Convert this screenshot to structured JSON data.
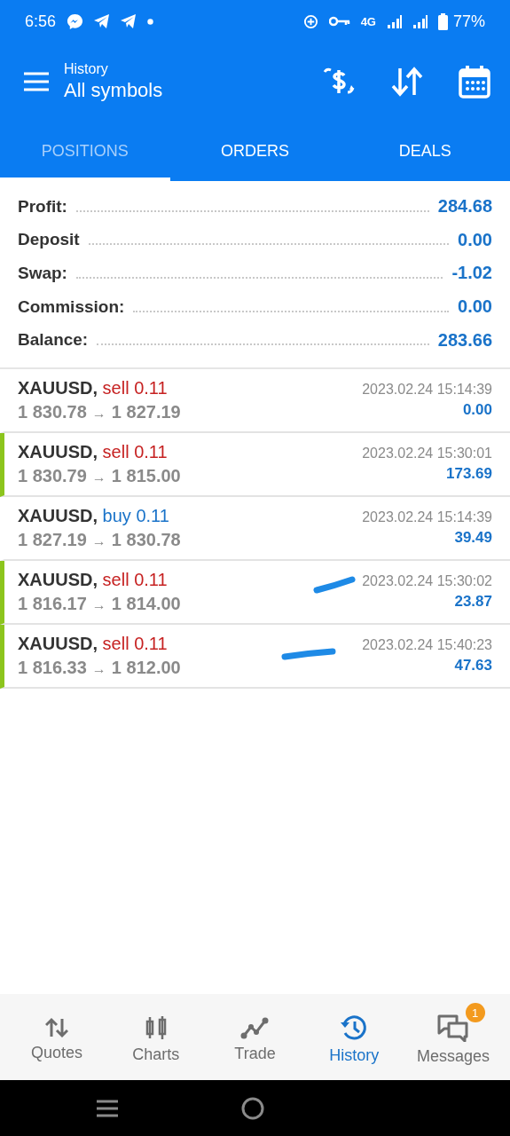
{
  "status_bar": {
    "time": "6:56",
    "battery": "77%",
    "network": "4G"
  },
  "header": {
    "subtitle": "History",
    "title": "All symbols"
  },
  "tabs": [
    {
      "label": "POSITIONS",
      "selected": true
    },
    {
      "label": "ORDERS",
      "selected": false
    },
    {
      "label": "DEALS",
      "selected": false
    }
  ],
  "summary": [
    {
      "label": "Profit:",
      "value": "284.68"
    },
    {
      "label": "Deposit",
      "value": "0.00"
    },
    {
      "label": "Swap:",
      "value": "-1.02"
    },
    {
      "label": "Commission:",
      "value": "0.00"
    },
    {
      "label": "Balance:",
      "value": "283.66"
    }
  ],
  "positions": [
    {
      "symbol": "XAUUSD,",
      "kind": "sell",
      "deal": "sell 0.11",
      "open": "1 830.78",
      "arrow": "→",
      "close": "1 827.19",
      "time": "2023.02.24 15:14:39",
      "profit": "0.00",
      "marked": false,
      "pen_mark": false
    },
    {
      "symbol": "XAUUSD,",
      "kind": "sell",
      "deal": "sell 0.11",
      "open": "1 830.79",
      "arrow": "→",
      "close": "1 815.00",
      "time": "2023.02.24 15:30:01",
      "profit": "173.69",
      "marked": true,
      "pen_mark": false
    },
    {
      "symbol": "XAUUSD,",
      "kind": "buy",
      "deal": "buy 0.11",
      "open": "1 827.19",
      "arrow": "→",
      "close": "1 830.78",
      "time": "2023.02.24 15:14:39",
      "profit": "39.49",
      "marked": false,
      "pen_mark": false
    },
    {
      "symbol": "XAUUSD,",
      "kind": "sell",
      "deal": "sell 0.11",
      "open": "1 816.17",
      "arrow": "→",
      "close": "1 814.00",
      "time": "2023.02.24 15:30:02",
      "profit": "23.87",
      "marked": true,
      "pen_mark": true
    },
    {
      "symbol": "XAUUSD,",
      "kind": "sell",
      "deal": "sell 0.11",
      "open": "1 816.33",
      "arrow": "→",
      "close": "1 812.00",
      "time": "2023.02.24 15:40:23",
      "profit": "47.63",
      "marked": true,
      "pen_mark": true
    }
  ],
  "bottom_nav": [
    {
      "label": "Quotes",
      "selected": false
    },
    {
      "label": "Charts",
      "selected": false
    },
    {
      "label": "Trade",
      "selected": false
    },
    {
      "label": "History",
      "selected": true
    },
    {
      "label": "Messages",
      "selected": false,
      "badge": "1"
    }
  ]
}
